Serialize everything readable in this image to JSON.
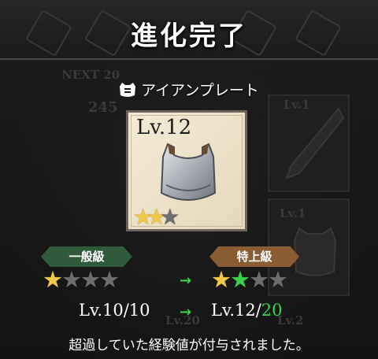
{
  "title": "進化完了",
  "item": {
    "name": "アイアンプレート",
    "level_label": "Lv.12",
    "card_stars": [
      "gold",
      "gold",
      "gray"
    ]
  },
  "before": {
    "rank": "一般級",
    "stars": [
      "gold",
      "gray",
      "gray",
      "gray"
    ],
    "level": "Lv.10/10"
  },
  "after": {
    "rank": "特上級",
    "stars": [
      "gold",
      "green",
      "gray",
      "gray"
    ],
    "level_current": "Lv.12/",
    "level_max": "20"
  },
  "arrow": "→",
  "message": "超過していた経験値が付与されました。",
  "background_text": {
    "next": "NEXT 20",
    "num": "245",
    "lv_a": "Lv.1",
    "lv_b": "Lv.1",
    "lv_c": "Lv.20",
    "lv_d": "Lv.2"
  },
  "colors": {
    "gold_star": "#f1c94a",
    "green_star": "#3ad34a",
    "gray_star": "#6e6e6e",
    "rank_common": "#2f5b3a",
    "rank_special": "#8a5c33"
  }
}
